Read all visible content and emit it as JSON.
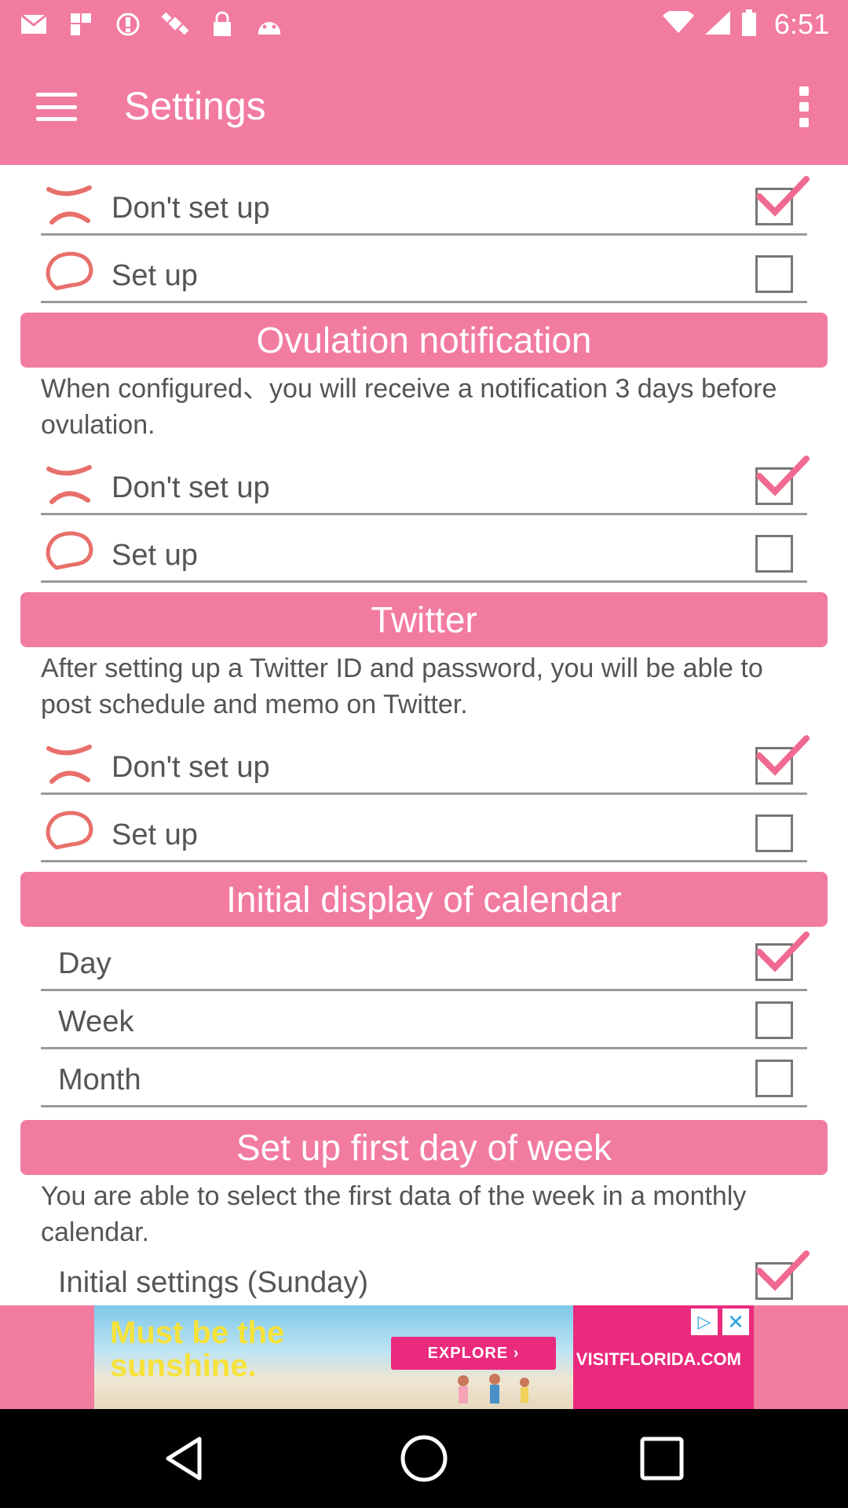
{
  "status_bar": {
    "time": "6:51",
    "left_icons": [
      "mail-icon",
      "bookmark-icon",
      "alert-circle-icon",
      "satellite-icon",
      "lock-icon",
      "android-icon"
    ],
    "right_icons": [
      "wifi-icon",
      "signal-icon",
      "battery-icon"
    ]
  },
  "app_bar": {
    "title": "Settings",
    "menu_icon": "hamburger-menu-icon",
    "overflow_icon": "more-vert-icon"
  },
  "sections": {
    "top": {
      "options": [
        {
          "label": "Don't set up",
          "icon": "cross-icon",
          "checked": true
        },
        {
          "label": "Set up",
          "icon": "circle-icon",
          "checked": false
        }
      ]
    },
    "ovulation": {
      "header": "Ovulation notification",
      "description": "When configured、you will receive a notification 3 days before ovulation.",
      "options": [
        {
          "label": "Don't set up",
          "icon": "cross-icon",
          "checked": true
        },
        {
          "label": "Set up",
          "icon": "circle-icon",
          "checked": false
        }
      ]
    },
    "twitter": {
      "header": "Twitter",
      "description": "After setting up a Twitter ID and password, you will be able to post schedule and memo on Twitter.",
      "options": [
        {
          "label": "Don't set up",
          "icon": "cross-icon",
          "checked": true
        },
        {
          "label": "Set up",
          "icon": "circle-icon",
          "checked": false
        }
      ]
    },
    "calendar": {
      "header": "Initial display of calendar",
      "options": [
        {
          "label": "Day",
          "checked": true
        },
        {
          "label": "Week",
          "checked": false
        },
        {
          "label": "Month",
          "checked": false
        }
      ]
    },
    "first_day": {
      "header": "Set up first day of week",
      "description": "You are able to select the first data of the week in a monthly calendar.",
      "options": [
        {
          "label": "Initial settings (Sunday)",
          "checked": true
        }
      ]
    }
  },
  "ad": {
    "headline": "Must be the sunshine.",
    "cta": "EXPLORE ›",
    "brand": "VISITFLORIDA.COM",
    "adchoices_icon": "adchoices-icon",
    "close_icon": "close-icon"
  },
  "nav_bar": {
    "back_icon": "back-triangle-icon",
    "home_icon": "home-circle-icon",
    "recents_icon": "recents-square-icon"
  },
  "colors": {
    "accent": "#f27ba0",
    "mark": "#e8706b",
    "check": "#f06a90"
  }
}
